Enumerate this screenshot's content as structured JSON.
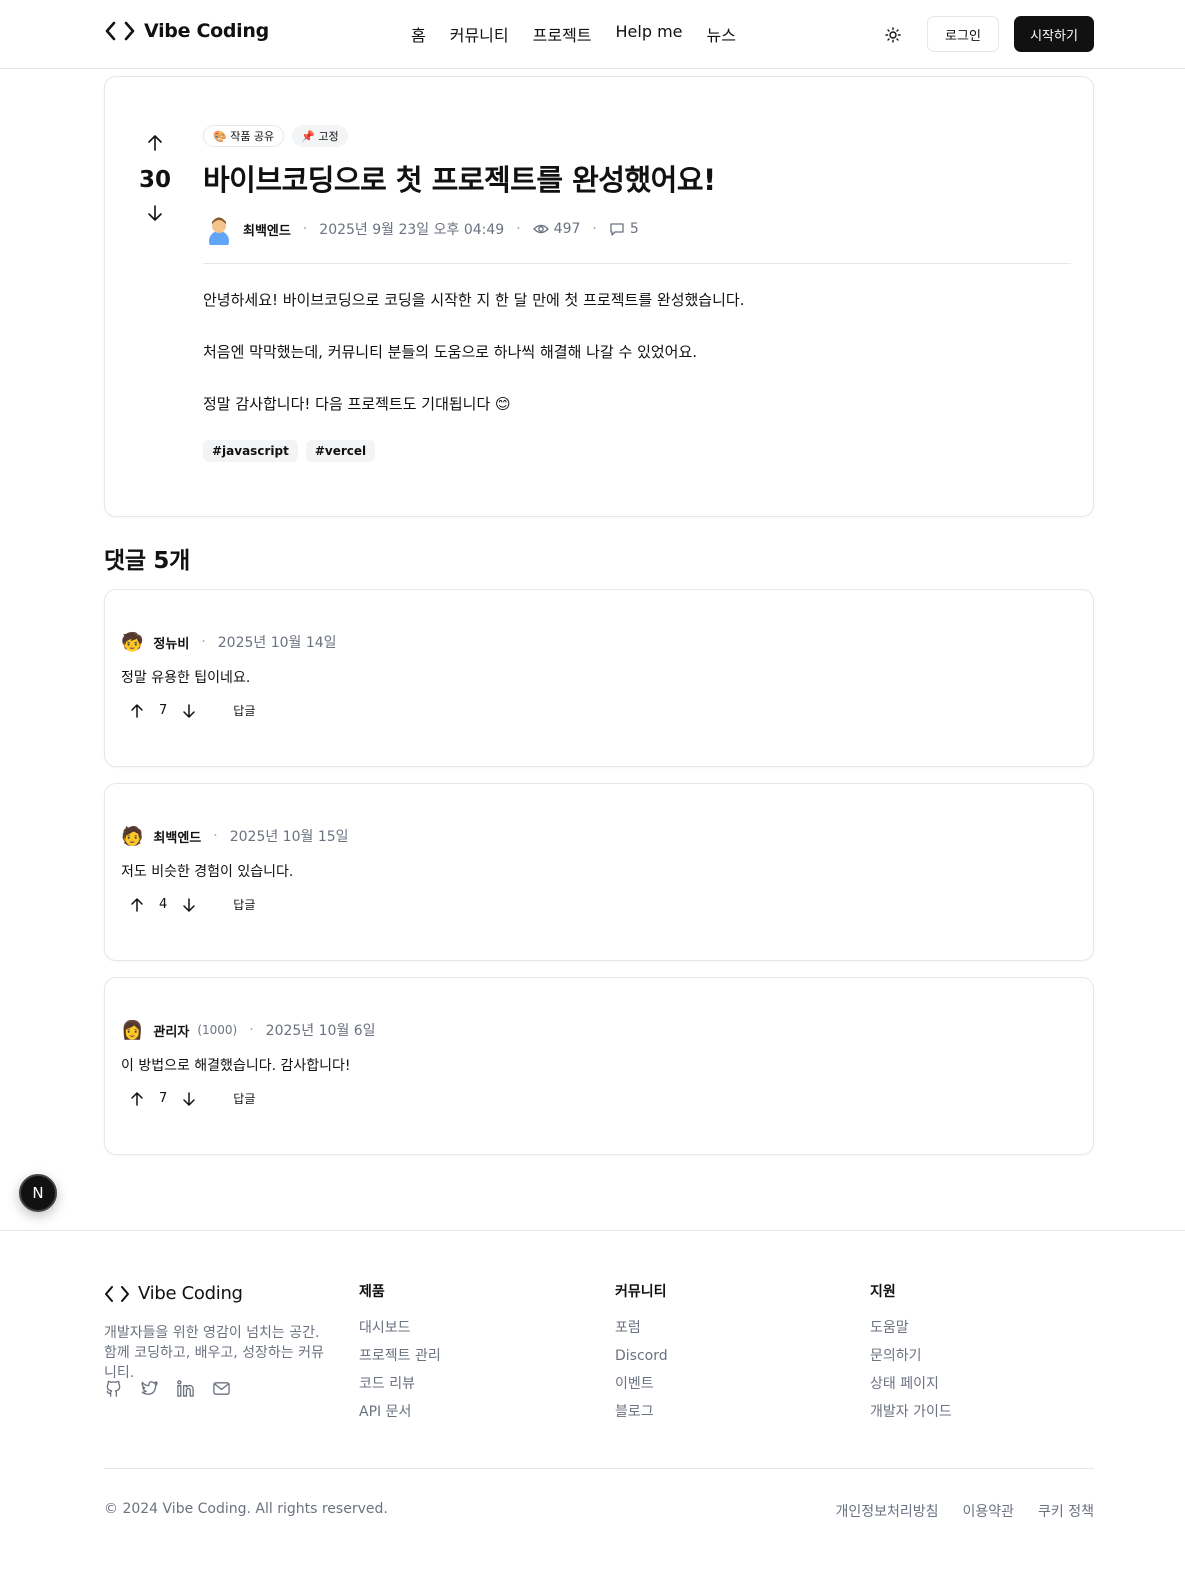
{
  "header": {
    "logo_text": "Vibe Coding",
    "nav": [
      "홈",
      "커뮤니티",
      "프로젝트",
      "Help me",
      "뉴스"
    ],
    "login_label": "로그인",
    "start_label": "시작하기"
  },
  "post": {
    "votes": "30",
    "badges": [
      "🎨 작품 공유",
      "📌 고정"
    ],
    "title": "바이브코딩으로 첫 프로젝트를 완성했어요!",
    "author": "최백엔드",
    "date": "2025년 9월 23일 오후 04:49",
    "views": "497",
    "comments": "5",
    "paragraphs": [
      "안녕하세요! 바이브코딩으로 코딩을 시작한 지 한 달 만에 첫 프로젝트를 완성했습니다.",
      "처음엔 막막했는데, 커뮤니티 분들의 도움으로 하나씩 해결해 나갈 수 있었어요.",
      "정말 감사합니다! 다음 프로젝트도 기대됩니다 😊"
    ],
    "tags": [
      "#javascript",
      "#vercel"
    ]
  },
  "comments_title": "댓글 5개",
  "comments": [
    {
      "name": "정뉴비",
      "level": "",
      "date": "2025년 10월 14일",
      "text": "정말 유용한 팁이네요.",
      "votes": "7",
      "reply": "답글",
      "avatar": "🧒"
    },
    {
      "name": "최백엔드",
      "level": "",
      "date": "2025년 10월 15일",
      "text": "저도 비슷한 경험이 있습니다.",
      "votes": "4",
      "reply": "답글",
      "avatar": "🧑"
    },
    {
      "name": "관리자",
      "level": "(1000)",
      "date": "2025년 10월 6일",
      "text": "이 방법으로 해결했습니다. 감사합니다!",
      "votes": "7",
      "reply": "답글",
      "avatar": "👩"
    }
  ],
  "fab_label": "N",
  "footer": {
    "brand": "Vibe Coding",
    "desc": "개발자들을 위한 영감이 넘치는 공간. 함께 코딩하고, 배우고, 성장하는 커뮤니티.",
    "columns": [
      {
        "title": "제품",
        "links": [
          "대시보드",
          "프로젝트 관리",
          "코드 리뷰",
          "API 문서"
        ]
      },
      {
        "title": "커뮤니티",
        "links": [
          "포럼",
          "Discord",
          "이벤트",
          "블로그"
        ]
      },
      {
        "title": "지원",
        "links": [
          "도움말",
          "문의하기",
          "상태 페이지",
          "개발자 가이드"
        ]
      }
    ],
    "copyright": "© 2024 Vibe Coding. All rights reserved.",
    "legal": [
      "개인정보처리방침",
      "이용약관",
      "쿠키 정책"
    ]
  }
}
